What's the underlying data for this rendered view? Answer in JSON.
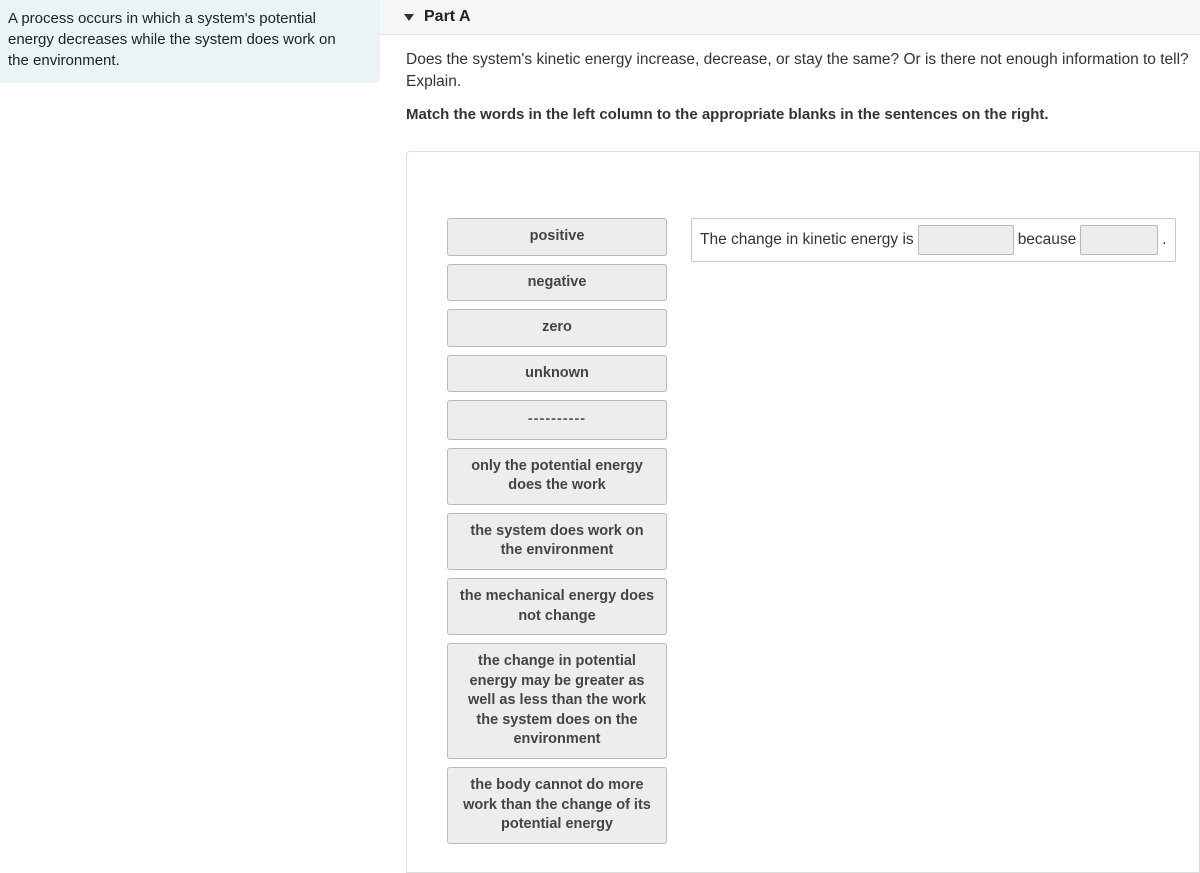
{
  "sidebar": {
    "prompt": "A process occurs in which a system's potential energy decreases while the system does work on the environment."
  },
  "part": {
    "label": "Part A"
  },
  "question": {
    "text": "Does the system's kinetic energy increase, decrease, or stay the same? Or is there not enough information to tell? Explain.",
    "instruction": "Match the words in the left column to the appropriate blanks in the sentences on the right."
  },
  "tiles": {
    "t0": "positive",
    "t1": "negative",
    "t2": "zero",
    "t3": "unknown",
    "divider": "----------",
    "t5": "only the potential energy does the work",
    "t6": "the system does work on the environment",
    "t7": "the mechanical energy does not change",
    "t8": "the change in potential energy may be greater as well as less than the work the system does on the environment",
    "t9": "the body cannot do more work than the change of its potential energy"
  },
  "sentence": {
    "pre": "The change in kinetic energy is",
    "mid": "because",
    "end": "."
  }
}
